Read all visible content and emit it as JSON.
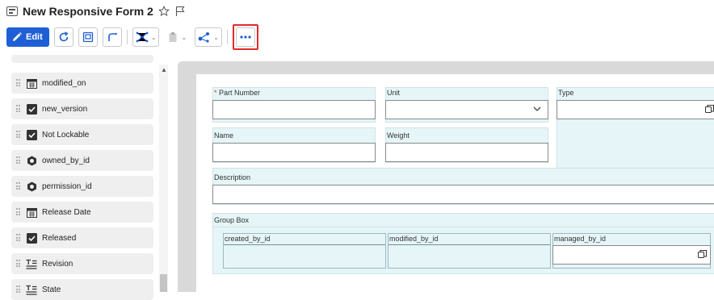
{
  "window": {
    "title": "New Responsive Form 2"
  },
  "toolbar": {
    "edit_label": "Edit"
  },
  "properties": [
    {
      "label": "modified_on",
      "icon": "calendar-icon"
    },
    {
      "label": "new_version",
      "icon": "checkbox-icon"
    },
    {
      "label": "Not Lockable",
      "icon": "checkbox-icon"
    },
    {
      "label": "owned_by_id",
      "icon": "item-icon"
    },
    {
      "label": "permission_id",
      "icon": "item-icon"
    },
    {
      "label": "Release Date",
      "icon": "calendar-icon"
    },
    {
      "label": "Released",
      "icon": "checkbox-icon"
    },
    {
      "label": "Revision",
      "icon": "list-icon"
    },
    {
      "label": "State",
      "icon": "list-icon"
    }
  ],
  "form": {
    "part_number": {
      "label": "Part Number",
      "required_mark": "*"
    },
    "unit": {
      "label": "Unit"
    },
    "type": {
      "label": "Type"
    },
    "name": {
      "label": "Name"
    },
    "weight": {
      "label": "Weight"
    },
    "description": {
      "label": "Description"
    },
    "group_box": {
      "label": "Group Box",
      "created_by": "created_by_id",
      "modified_by": "modified_by_id",
      "managed_by": "managed_by_id"
    }
  },
  "colors": {
    "accent": "#1f5fd6",
    "highlight_border": "#e12b2b",
    "field_bg": "#e5f5f8",
    "canvas_bg": "#d9d9d9"
  }
}
